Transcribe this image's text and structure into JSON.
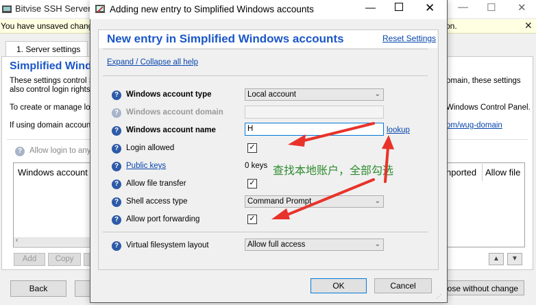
{
  "background": {
    "window_title": "Bitvise SSH Server",
    "warning_text": "You have unsaved changes",
    "warning_text_right": "on.",
    "warning_close": "✕",
    "tab_label": "1. Server settings",
    "heading": "Simplified Wind",
    "paragraph1_line1": "These settings control S",
    "paragraph1_line2": "also control login rights a",
    "paragraph1_right": "omain, these settings",
    "paragraph2": "To create or manage loc",
    "paragraph2_right": "Windows Control Panel.",
    "paragraph3": "If using domain accounts",
    "paragraph3_link": "om/wug-domain",
    "allow_login_label": "Allow login to any",
    "table_headers": [
      "Windows account",
      "nported",
      "Allow file"
    ],
    "add_button": "Add",
    "copy_button": "Copy",
    "back_button": "Back",
    "close_without_change_button": "lose without change"
  },
  "dialog": {
    "title": "Adding new entry to Simplified Windows accounts",
    "heading": "New entry in Simplified Windows accounts",
    "reset_link": "Reset Settings",
    "expand_link": "Expand / Collapse all help",
    "rows": {
      "account_type": {
        "label": "Windows account type",
        "value": "Local account"
      },
      "account_domain": {
        "label": "Windows account domain",
        "value": ""
      },
      "account_name": {
        "label": "Windows account name",
        "value": "H",
        "lookup": "lookup"
      },
      "login_allowed": {
        "label": "Login allowed",
        "checked": true
      },
      "public_keys": {
        "label": "Public keys",
        "value": "0 keys"
      },
      "file_transfer": {
        "label": "Allow file transfer",
        "checked": true
      },
      "shell_access": {
        "label": "Shell access type",
        "value": "Command Prompt"
      },
      "port_forwarding": {
        "label": "Allow port forwarding",
        "checked": true
      },
      "vfs_layout": {
        "label": "Virtual filesystem layout",
        "value": "Allow full access"
      }
    },
    "ok_button": "OK",
    "cancel_button": "Cancel"
  },
  "annotation": {
    "note": "查找本地账户，全部勾选",
    "arrow_color": "#e8332a"
  },
  "colors": {
    "heading_blue": "#1a56c8",
    "link_blue": "#0645ad",
    "help_icon_blue": "#2d5aa8",
    "note_green": "#2e8b2e"
  }
}
